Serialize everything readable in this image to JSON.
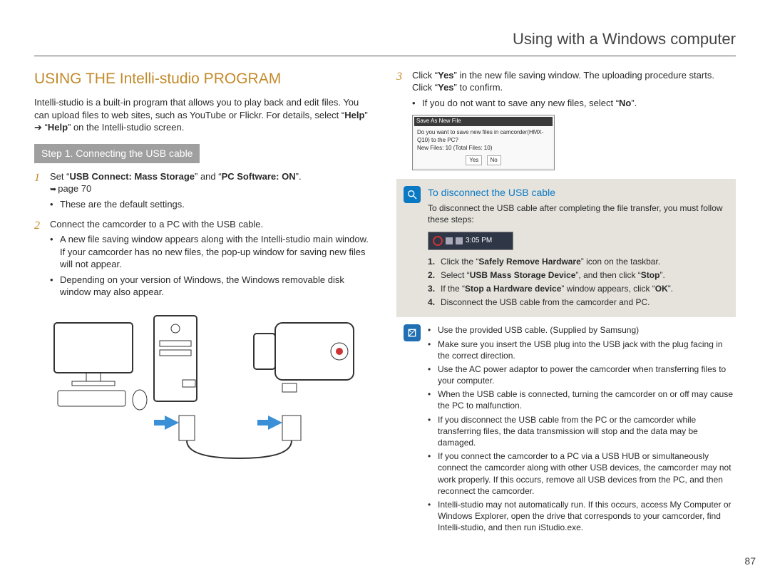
{
  "chapter_title": "Using with a Windows computer",
  "section_title": "USING THE Intelli-studio PROGRAM",
  "intro_pre": "Intelli-studio is a built-in program that allows you to play back and edit files. You can upload files to web sites, such as YouTube or Flickr. For details, select “",
  "intro_help1": "Help",
  "intro_arrow": "” ➔ “",
  "intro_help2": "Help",
  "intro_post": "” on the Intelli-studio screen.",
  "step_bar": "Step 1. Connecting the USB cable",
  "left_steps": {
    "s1_pre": "Set “",
    "s1_b1": "USB Connect: Mass Storage",
    "s1_mid": "” and “",
    "s1_b2": "PC Software: ON",
    "s1_post": "”.",
    "s1_pageref": "page 70",
    "s1_bul": "These are the default settings.",
    "s2_main": "Connect the camcorder to a PC with the USB cable.",
    "s2_b1": "A new file saving window appears along with the Intelli-studio main window. If your camcorder has no new files, the pop-up window for saving new files will not appear.",
    "s2_b2": "Depending on your version of Windows, the Windows removable disk window may also appear."
  },
  "right": {
    "s3_pre": "Click “",
    "s3_b1": "Yes",
    "s3_mid1": "” in the new file saving window. The uploading procedure starts. Click “",
    "s3_b2": "Yes",
    "s3_mid2": "” to confirm.",
    "s3_bul_pre": "If you do not want to save any new files, select “",
    "s3_bul_b": "No",
    "s3_bul_post": "”.",
    "dialog": {
      "title": "Save As New File",
      "line1": "Do you want to save new files in camcorder(HMX-Q10) to the PC?",
      "line2": "New Files: 10 (Total Files: 10)",
      "yes": "Yes",
      "no": "No"
    },
    "callout": {
      "title": "To disconnect the USB cable",
      "desc": "To disconnect the USB cable after completing the file transfer, you must follow these steps:",
      "tray_time": "3:05 PM",
      "l1_pre": "Click the “",
      "l1_b": "Safely Remove Hardware",
      "l1_post": "” icon on the taskbar.",
      "l2_pre": "Select “",
      "l2_b": "USB Mass Storage Device",
      "l2_mid": "”, and then click “",
      "l2_b2": "Stop",
      "l2_post": "”.",
      "l3_pre": "If the “",
      "l3_b": "Stop a Hardware device",
      "l3_mid": "” window appears, click “",
      "l3_b2": "OK",
      "l3_post": "”.",
      "l4": "Disconnect the USB cable from the camcorder and PC."
    },
    "notes": {
      "n1": "Use the provided USB cable. (Supplied by Samsung)",
      "n2": "Make sure you insert the USB plug into the USB jack with the plug facing in the correct direction.",
      "n3": "Use the AC power adaptor to power the camcorder when transferring files to your computer.",
      "n4": "When the USB cable is connected, turning the camcorder on or off may cause the PC to malfunction.",
      "n5": "If you disconnect the USB cable from the PC or the camcorder while transferring files, the data transmission will stop and the data may be damaged.",
      "n6": "If you connect the camcorder to a PC via a USB HUB or simultaneously connect the camcorder along with other USB devices, the camcorder may not work properly. If this occurs, remove all USB devices from the PC, and then reconnect the camcorder.",
      "n7": "Intelli-studio may not automatically run. If this occurs, access My Computer or Windows Explorer, open the drive that corresponds to your camcorder, find Intelli-studio, and then run iStudio.exe."
    }
  },
  "page_number": "87"
}
